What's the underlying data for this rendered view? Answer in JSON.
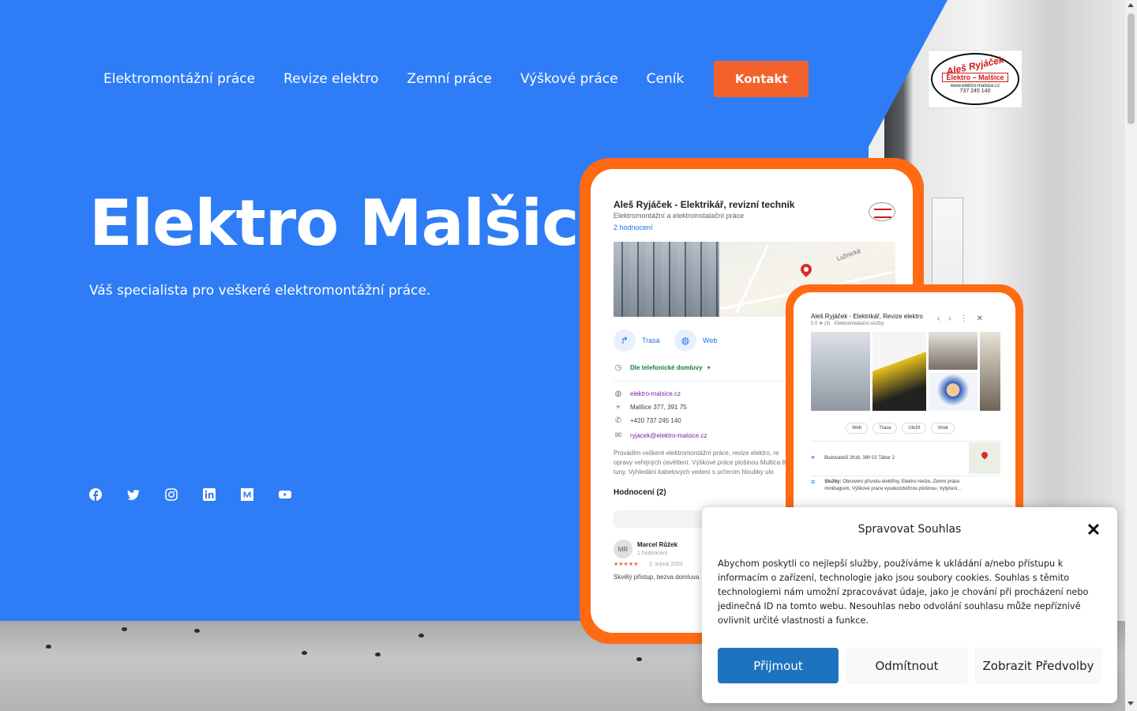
{
  "nav": {
    "items": [
      {
        "label": "Elektromontážní práce"
      },
      {
        "label": "Revize elektro"
      },
      {
        "label": "Zemní práce"
      },
      {
        "label": "Výškové práce"
      },
      {
        "label": "Ceník"
      }
    ],
    "contact_label": "Kontakt"
  },
  "logo": {
    "line1": "Aleš Ryjáček",
    "line2": "Elektro – Malšice",
    "line3": "www.elektro-malsice.cz",
    "line4": "737 245 140"
  },
  "hero": {
    "title": "Elektro Malšice",
    "subtitle": "Váš specialista pro veškeré elektromontážní práce."
  },
  "socials": [
    "facebook-icon",
    "twitter-icon",
    "instagram-icon",
    "linkedin-icon",
    "medium-icon",
    "youtube-icon"
  ],
  "mockup1": {
    "title": "Aleš Ryjáček - Elektrikář, revizní technik",
    "category": "Elektromontážní a elektroinstalační práce",
    "reviews_link": "2 hodnocení",
    "map_label": "Lužnická",
    "action_route": "Trasa",
    "action_web": "Web",
    "hours": "Dle telefonické domluvy",
    "website": "elektro-malsice.cz",
    "address": "Malšice 377, 391 75",
    "phone": "+420 737 245 140",
    "email": "ryjacek@elektro-malsice.cz",
    "description": "Provádím veškeré elektromontážní práce, revize elektro, re opravy veřejných osvětlení. Výškové práce plošinou Multica 8 tuny. Vyhledání kabelových vedení s určením hloubky ulo",
    "rating_heading": "Hodnocení",
    "rating_count": "(2)",
    "reviewer_initials": "MR",
    "reviewer_name": "Marcel Růžek",
    "reviewer_reviews": "1 hodnocení",
    "review_stars": "★★★★★",
    "review_date": "2. srpna 2023",
    "review_text": "Skvělý přístup, bezva domluva"
  },
  "mockup2": {
    "title": "Aleš Ryjáček - Elektrikář, Revize elektro",
    "subtitle": "5.0 ★ (3) · Elektroinstalační služby",
    "btn_web": "Web",
    "btn_route": "Trasa",
    "btn_save": "Uložit",
    "btn_call": "Volat",
    "address": "Budovatelů 2616, 390 02 Tábor 2",
    "services_label": "Služby:",
    "services": "Obnovení přívodu elektřiny, Elektro revize, Zemní práce minibagrem, Výškové práce vysokozdvižnou plošinou, Vytýčení…"
  },
  "consent": {
    "title": "Spravovat Souhlas",
    "text": "Abychom poskytli co nejlepší služby, používáme k ukládání a/nebo přístupu k informacím o zařízení, technologie jako jsou soubory cookies. Souhlas s těmito technologiemi nám umožní zpracovávat údaje, jako je chování při procházení nebo jedinečná ID na tomto webu. Nesouhlas nebo odvolání souhlasu může nepříznivě ovlivnit určité vlastnosti a funkce.",
    "accept_label": "Přijmout",
    "deny_label": "Odmítnout",
    "prefs_label": "Zobrazit Předvolby"
  },
  "colors": {
    "hero_blue": "#2e7df6",
    "accent_orange": "#f4622c",
    "consent_blue": "#1e73be"
  }
}
